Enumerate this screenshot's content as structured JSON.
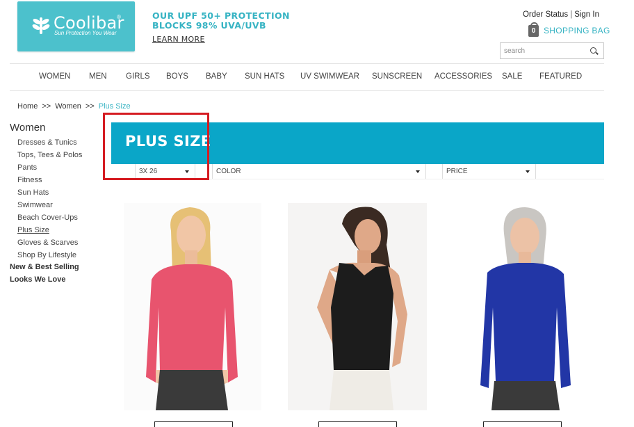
{
  "brand": {
    "name": "Coolibar",
    "registered": "®",
    "tagline": "Sun Protection You Wear"
  },
  "promo": {
    "line1": "OUR UPF 50+ PROTECTION",
    "line2": "BLOCKS 98% UVA/UVB",
    "learn_more": "LEARN MORE"
  },
  "account": {
    "order_status": "Order Status",
    "separator": "|",
    "sign_in": "Sign In"
  },
  "bag": {
    "count": "0",
    "label": "SHOPPING BAG"
  },
  "search": {
    "placeholder": "search"
  },
  "nav": [
    "WOMEN",
    "MEN",
    "GIRLS",
    "BOYS",
    "BABY",
    "SUN HATS",
    "UV SWIMWEAR",
    "SUNSCREEN",
    "ACCESSORIES",
    "SALE",
    "FEATURED"
  ],
  "breadcrumb": {
    "home": "Home",
    "separator": ">>",
    "section": "Women",
    "current": "Plus Size"
  },
  "sidebar": {
    "title": "Women",
    "items": [
      "Dresses & Tunics",
      "Tops, Tees & Polos",
      "Pants",
      "Fitness",
      "Sun Hats",
      "Swimwear",
      "Beach Cover-Ups",
      "Plus Size",
      "Gloves & Scarves",
      "Shop By Lifestyle"
    ],
    "active": "Plus Size",
    "extra": [
      "New & Best Selling",
      "Looks We Love"
    ]
  },
  "banner": {
    "title": "PLUS SIZE"
  },
  "filters": {
    "size": "3X 26",
    "color": "COLOR",
    "price": "PRICE"
  },
  "colors": {
    "accent": "#36b3c3",
    "banner": "#0aa6c8",
    "logo_bg": "#4cc1cc",
    "highlight": "#d51c22",
    "pink_top": "#e8546e",
    "black_top": "#1c1c1c",
    "blue_top": "#2236a6"
  }
}
